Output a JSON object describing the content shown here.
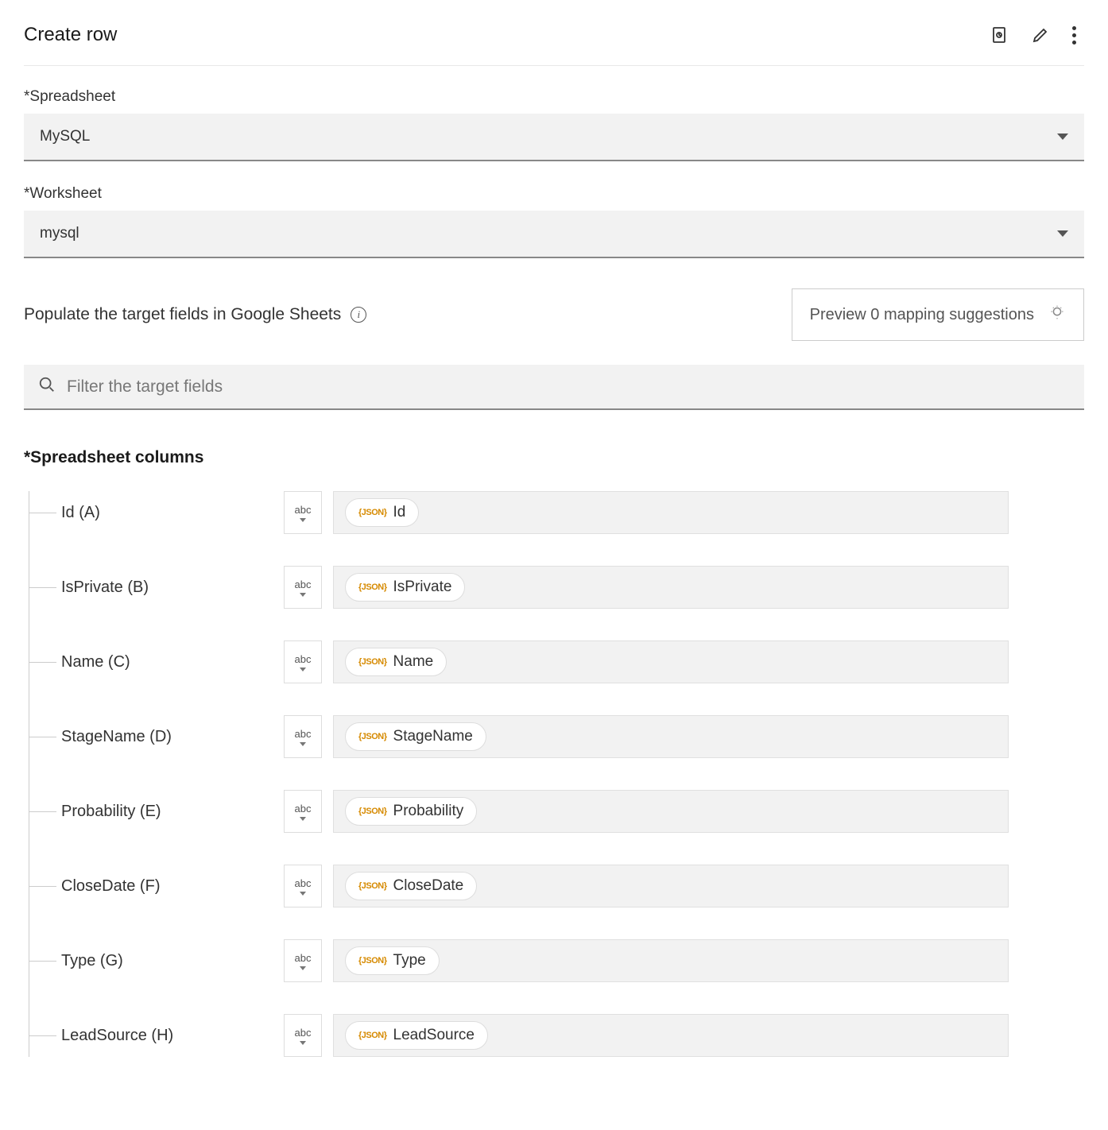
{
  "header": {
    "title": "Create row",
    "icons": {
      "duplicate": "duplicate-icon",
      "edit": "pencil-icon",
      "more": "more-icon"
    }
  },
  "spreadsheet": {
    "label": "*Spreadsheet",
    "value": "MySQL"
  },
  "worksheet": {
    "label": "*Worksheet",
    "value": "mysql"
  },
  "populate": {
    "text": "Populate the target fields in Google Sheets",
    "preview_button": "Preview 0 mapping suggestions"
  },
  "filter": {
    "placeholder": "Filter the target fields"
  },
  "columns": {
    "title": "*Spreadsheet columns",
    "type_label": "abc",
    "json_tag": "JSON",
    "items": [
      {
        "label": "Id (A)",
        "mapped": "Id"
      },
      {
        "label": "IsPrivate (B)",
        "mapped": "IsPrivate"
      },
      {
        "label": "Name (C)",
        "mapped": "Name"
      },
      {
        "label": "StageName (D)",
        "mapped": "StageName"
      },
      {
        "label": "Probability (E)",
        "mapped": "Probability"
      },
      {
        "label": "CloseDate (F)",
        "mapped": "CloseDate"
      },
      {
        "label": "Type (G)",
        "mapped": "Type"
      },
      {
        "label": "LeadSource (H)",
        "mapped": "LeadSource"
      }
    ]
  }
}
